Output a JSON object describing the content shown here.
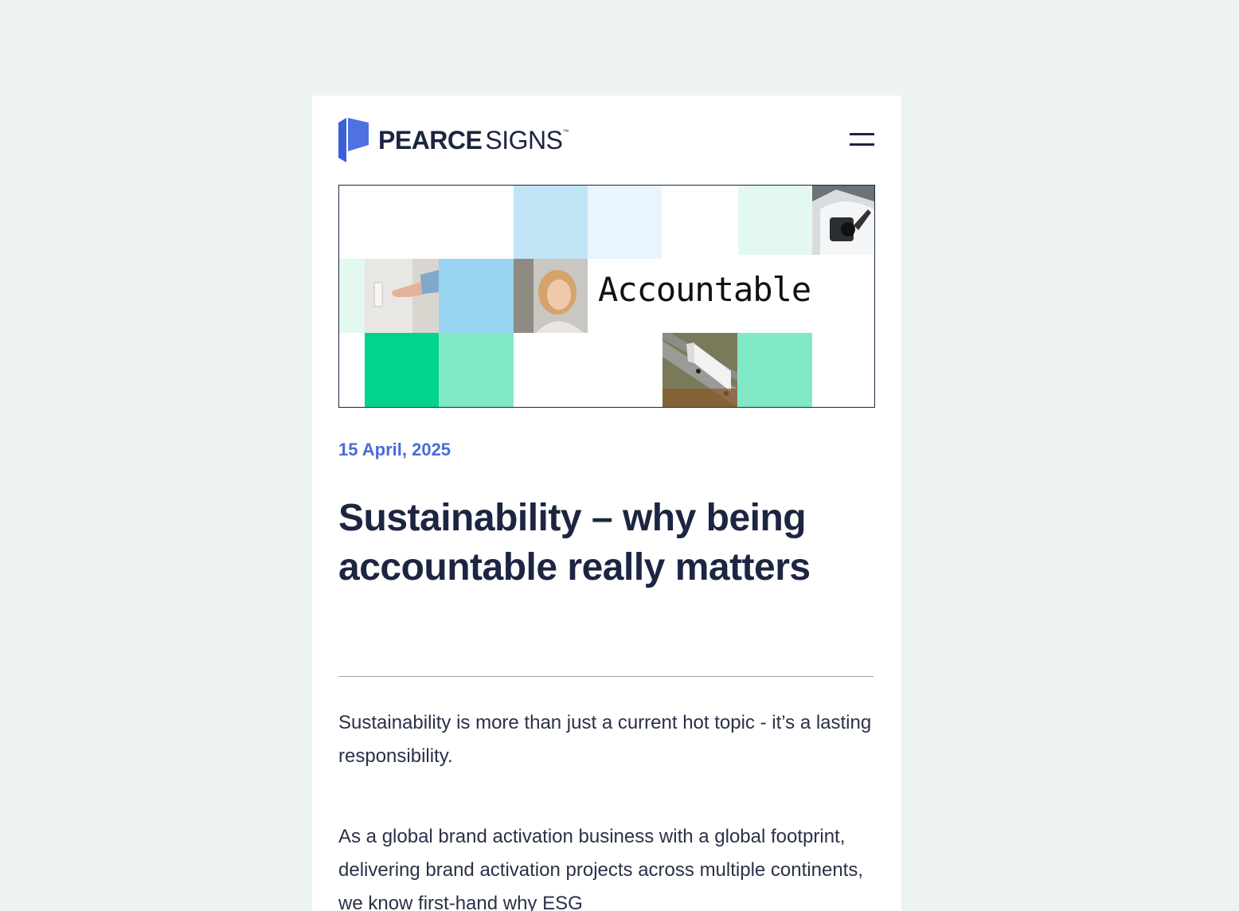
{
  "header": {
    "logo_strong": "PEARCE",
    "logo_light": "SIGNS",
    "logo_tm": "™",
    "menu_icon": "hamburger-menu-icon"
  },
  "hero": {
    "word": "Accountable",
    "colors": {
      "light_blue": "#c0e4f6",
      "pale_blue": "#e8f5fc",
      "mid_blue": "#98d4f0",
      "mint_pale": "#e3f8f0",
      "green": "#03d48c",
      "mint": "#82e9c7"
    },
    "images": [
      "finger-pressing-button-photo",
      "smiling-woman-photo",
      "ev-charger-photo",
      "truck-on-highway-photo"
    ]
  },
  "article": {
    "date": "15 April, 2025",
    "title": "Sustainability – why being accountable really matters",
    "paragraphs": [
      "Sustainability is more than just a current hot topic - it’s a lasting responsibility.",
      "As a global brand activation business with a global footprint, delivering brand activation projects across multiple continents, we know first-hand why ESG"
    ]
  },
  "colors": {
    "background": "#edf3f2",
    "navy": "#1c2541",
    "accent_blue": "#4a6bd6"
  }
}
